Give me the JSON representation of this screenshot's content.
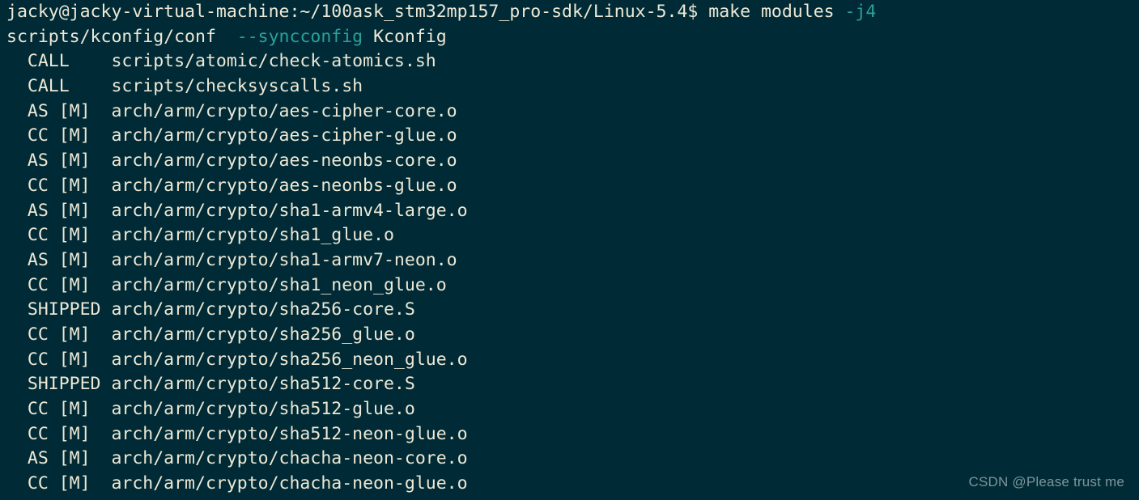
{
  "terminal": {
    "background_color": "#002b36",
    "foreground_color": "#eee8d5",
    "accent_color": "#2aa198",
    "watermark_color": "#93a7ad",
    "lines": [
      {
        "name": "prompt-command-line",
        "segments": [
          {
            "text": "jacky@jacky-virtual-machine:~/100ask_stm32mp157_pro-sdk/Linux-5.4$ make modules ",
            "color": "base"
          },
          {
            "text": "-j4",
            "color": "cyan"
          }
        ]
      },
      {
        "name": "kconfig-syncconfig-line",
        "segments": [
          {
            "text": "scripts/kconfig/conf  ",
            "color": "base"
          },
          {
            "text": "--syncconfig",
            "color": "cyan"
          },
          {
            "text": " Kconfig",
            "color": "base"
          }
        ]
      },
      {
        "name": "build-line-call-check-atomics",
        "segments": [
          {
            "text": "  CALL    scripts/atomic/check-atomics.sh",
            "color": "base"
          }
        ]
      },
      {
        "name": "build-line-call-checksyscalls",
        "segments": [
          {
            "text": "  CALL    scripts/checksyscalls.sh",
            "color": "base"
          }
        ]
      },
      {
        "name": "build-line-as-aes-cipher-core",
        "segments": [
          {
            "text": "  AS [M]  arch/arm/crypto/aes-cipher-core.o",
            "color": "base"
          }
        ]
      },
      {
        "name": "build-line-cc-aes-cipher-glue",
        "segments": [
          {
            "text": "  CC [M]  arch/arm/crypto/aes-cipher-glue.o",
            "color": "base"
          }
        ]
      },
      {
        "name": "build-line-as-aes-neonbs-core",
        "segments": [
          {
            "text": "  AS [M]  arch/arm/crypto/aes-neonbs-core.o",
            "color": "base"
          }
        ]
      },
      {
        "name": "build-line-cc-aes-neonbs-glue",
        "segments": [
          {
            "text": "  CC [M]  arch/arm/crypto/aes-neonbs-glue.o",
            "color": "base"
          }
        ]
      },
      {
        "name": "build-line-as-sha1-armv4-large",
        "segments": [
          {
            "text": "  AS [M]  arch/arm/crypto/sha1-armv4-large.o",
            "color": "base"
          }
        ]
      },
      {
        "name": "build-line-cc-sha1-glue",
        "segments": [
          {
            "text": "  CC [M]  arch/arm/crypto/sha1_glue.o",
            "color": "base"
          }
        ]
      },
      {
        "name": "build-line-as-sha1-armv7-neon",
        "segments": [
          {
            "text": "  AS [M]  arch/arm/crypto/sha1-armv7-neon.o",
            "color": "base"
          }
        ]
      },
      {
        "name": "build-line-cc-sha1-neon-glue",
        "segments": [
          {
            "text": "  CC [M]  arch/arm/crypto/sha1_neon_glue.o",
            "color": "base"
          }
        ]
      },
      {
        "name": "build-line-shipped-sha256-core",
        "segments": [
          {
            "text": "  SHIPPED arch/arm/crypto/sha256-core.S",
            "color": "base"
          }
        ]
      },
      {
        "name": "build-line-cc-sha256-glue",
        "segments": [
          {
            "text": "  CC [M]  arch/arm/crypto/sha256_glue.o",
            "color": "base"
          }
        ]
      },
      {
        "name": "build-line-cc-sha256-neon-glue",
        "segments": [
          {
            "text": "  CC [M]  arch/arm/crypto/sha256_neon_glue.o",
            "color": "base"
          }
        ]
      },
      {
        "name": "build-line-shipped-sha512-core",
        "segments": [
          {
            "text": "  SHIPPED arch/arm/crypto/sha512-core.S",
            "color": "base"
          }
        ]
      },
      {
        "name": "build-line-cc-sha512-glue",
        "segments": [
          {
            "text": "  CC [M]  arch/arm/crypto/sha512-glue.o",
            "color": "base"
          }
        ]
      },
      {
        "name": "build-line-cc-sha512-neon-glue",
        "segments": [
          {
            "text": "  CC [M]  arch/arm/crypto/sha512-neon-glue.o",
            "color": "base"
          }
        ]
      },
      {
        "name": "build-line-as-chacha-neon-core",
        "segments": [
          {
            "text": "  AS [M]  arch/arm/crypto/chacha-neon-core.o",
            "color": "base"
          }
        ]
      },
      {
        "name": "build-line-cc-chacha-neon-glue",
        "segments": [
          {
            "text": "  CC [M]  arch/arm/crypto/chacha-neon-glue.o",
            "color": "base"
          }
        ]
      }
    ]
  },
  "watermark": {
    "text": "CSDN @Please trust me"
  }
}
